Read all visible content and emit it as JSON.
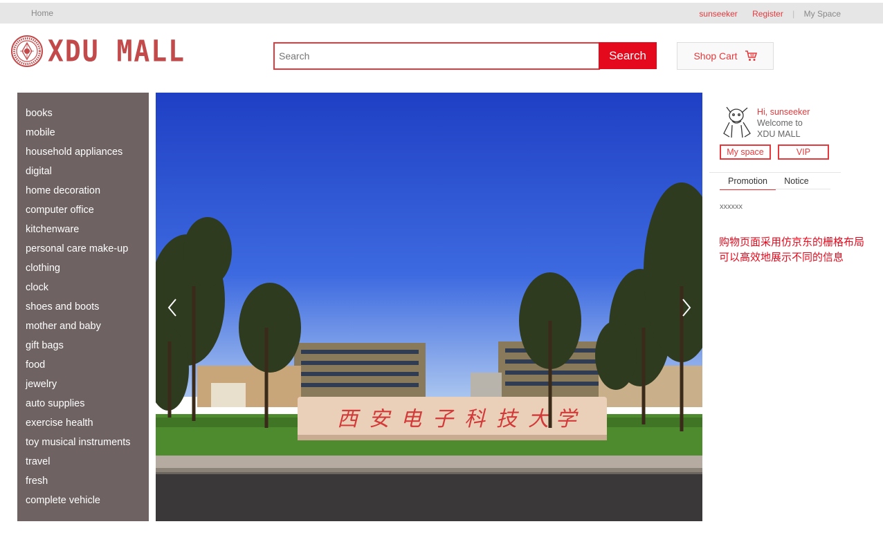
{
  "topbar": {
    "home": "Home",
    "username": "sunseeker",
    "register": "Register",
    "separator": "|",
    "myspace": "My Space"
  },
  "header": {
    "logo_text": "XDU MALL",
    "search_placeholder": "Search",
    "search_button": "Search",
    "cart_label": "Shop Cart"
  },
  "categories": [
    "books",
    "mobile",
    "household appliances",
    "digital",
    "home decoration",
    "computer office",
    "kitchenware",
    "personal care make-up",
    "clothing",
    "clock",
    "shoes and boots",
    "mother and baby",
    "gift bags",
    "food",
    "jewelry",
    "auto supplies",
    "exercise health",
    "toy musical instruments",
    "travel",
    "fresh",
    "complete vehicle"
  ],
  "user_panel": {
    "greeting": "Hi, sunseeker",
    "welcome_line1": "Welcome to",
    "welcome_line2": "XDU MALL",
    "myspace_button": "My space",
    "vip_button": "VIP",
    "tabs": [
      "Promotion",
      "Notice"
    ],
    "active_tab": "Promotion",
    "content": "xxxxxx"
  },
  "note": {
    "line1": "购物页面采用仿京东的栅格布局",
    "line2": "可以高效地展示不同的信息"
  },
  "colors": {
    "accent": "#e4393c",
    "button_red": "#e4091c",
    "menu_bg": "#6e6262",
    "topbar_bg": "#e6e6e7"
  }
}
